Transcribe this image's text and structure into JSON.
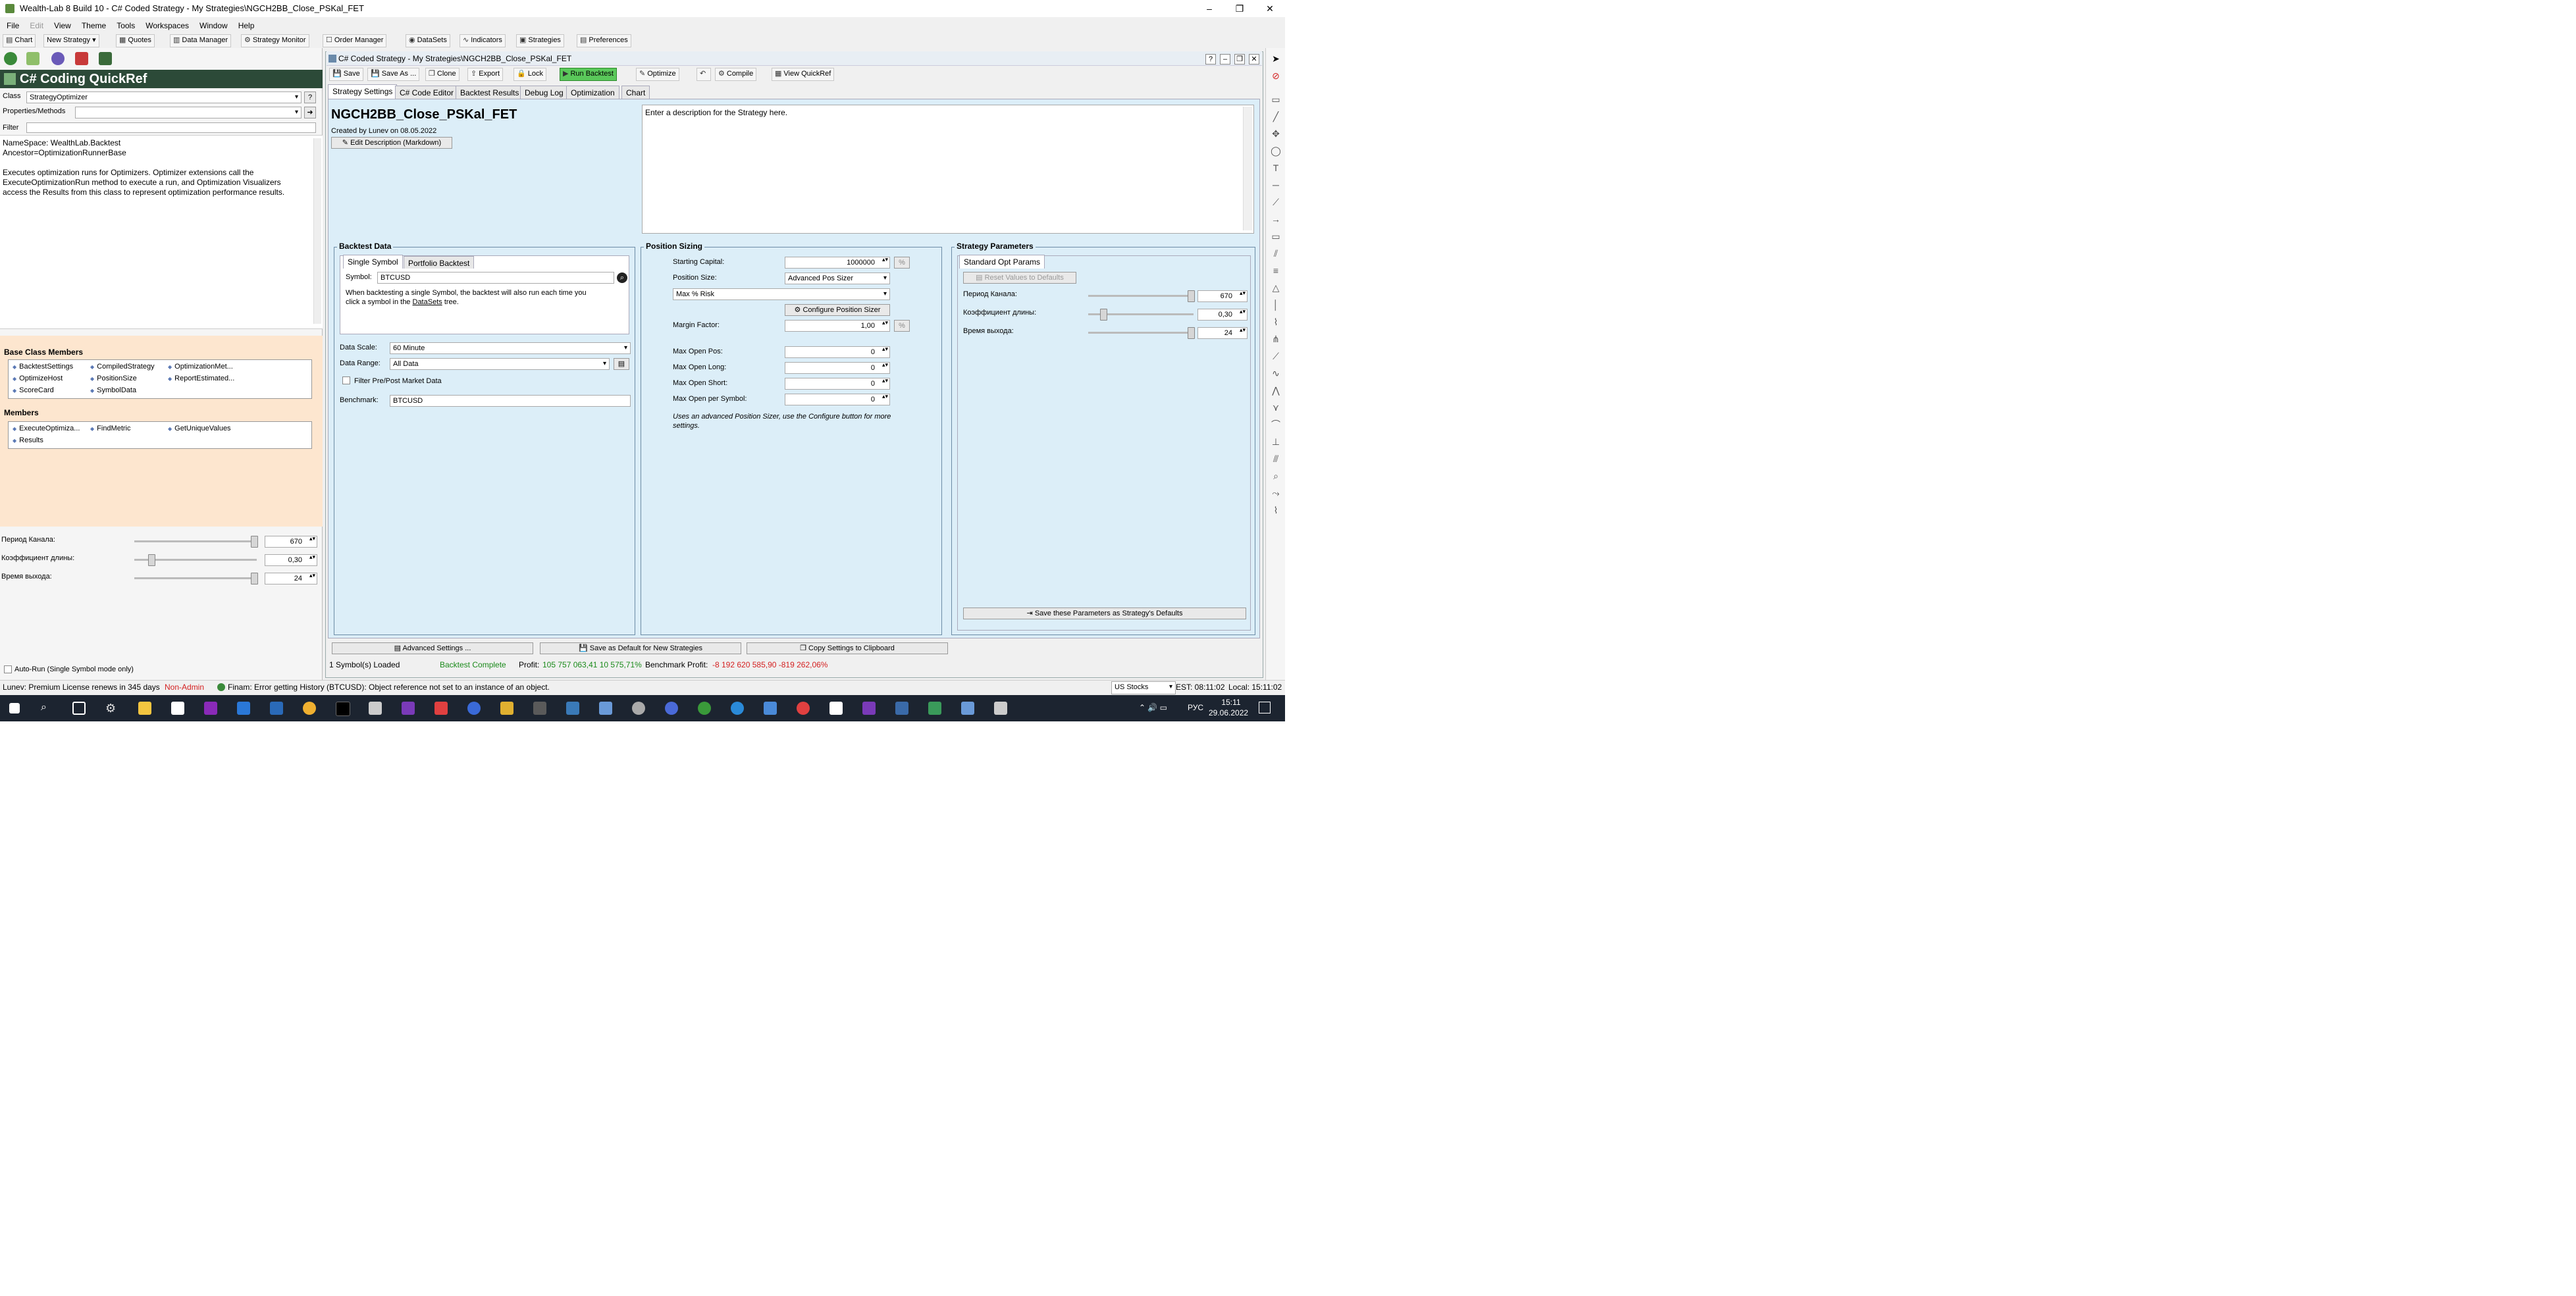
{
  "window": {
    "title": "Wealth-Lab 8 Build 10 - C# Coded Strategy - My Strategies\\NGCH2BB_Close_PSKal_FET",
    "controls": [
      "–",
      "❐",
      "✕"
    ]
  },
  "menu": [
    "File",
    "Edit",
    "View",
    "Theme",
    "Tools",
    "Workspaces",
    "Window",
    "Help"
  ],
  "toolbar": {
    "chart": "Chart",
    "new_strategy": "New Strategy",
    "quotes": "Quotes",
    "data_manager": "Data Manager",
    "strategy_monitor": "Strategy Monitor",
    "order_manager": "Order Manager",
    "datasets": "DataSets",
    "indicators": "Indicators",
    "strategies": "Strategies",
    "preferences": "Preferences"
  },
  "quickref": {
    "title": "C# Coding QuickRef",
    "class_label": "Class",
    "class_value": "StrategyOptimizer",
    "class_help": "?",
    "props_label": "Properties/Methods",
    "filter_label": "Filter",
    "description": [
      "NameSpace: WealthLab.Backtest",
      "Ancestor=OptimizationRunnerBase",
      "",
      "Executes optimization runs for Optimizers. Optimizer extensions call the",
      "ExecuteOptimizationRun method to execute a run, and Optimization Visualizers",
      "access the Results from this class to represent optimization performance results."
    ],
    "base_class_title": "Base Class Members",
    "base_members": [
      "BacktestSettings",
      "CompiledStrategy",
      "OptimizationMet...",
      "OptimizeHost",
      "PositionSize",
      "ReportEstimated...",
      "ScoreCard",
      "SymbolData"
    ],
    "members_title": "Members",
    "members": [
      "ExecuteOptimiza...",
      "FindMetric",
      "GetUniqueValues",
      "Results"
    ]
  },
  "left_params": [
    {
      "label": "Период Канала:",
      "value": "670",
      "level": 1.0
    },
    {
      "label": "Коэффициент длины:",
      "value": "0,30",
      "level": 0.12
    },
    {
      "label": "Время выхода:",
      "value": "24",
      "level": 1.0
    }
  ],
  "autorun_label": "Auto-Run (Single Symbol mode only)",
  "doc": {
    "title": "C# Coded Strategy - My Strategies\\NGCH2BB_Close_PSKal_FET",
    "buttons": {
      "save": "Save",
      "save_as": "Save As ...",
      "clone": "Clone",
      "export": "Export",
      "lock": "Lock",
      "run": "Run Backtest",
      "optimize": "Optimize",
      "compile": "Compile",
      "quickref": "View QuickRef"
    },
    "tabs": [
      "Strategy Settings",
      "C# Code Editor",
      "Backtest Results",
      "Debug Log",
      "Optimization",
      "Chart"
    ]
  },
  "strategy": {
    "name": "NGCH2BB_Close_PSKal_FET",
    "created": "Created by Lunev on 08.05.2022",
    "edit_desc": "Edit Description (Markdown)",
    "description_placeholder": "Enter a description for the Strategy here."
  },
  "backtest_data": {
    "title": "Backtest Data",
    "tabs": [
      "Single Symbol",
      "Portfolio Backtest"
    ],
    "symbol_label": "Symbol:",
    "symbol": "BTCUSD",
    "note_1": "When backtesting a single Symbol, the backtest will also run each time you",
    "note_2": "click a symbol in the",
    "note_link": "DataSets",
    "note_3": "tree.",
    "scale_label": "Data Scale:",
    "scale": "60 Minute",
    "range_label": "Data Range:",
    "range": "All Data",
    "filter_label": "Filter Pre/Post Market Data",
    "benchmark_label": "Benchmark:",
    "benchmark": "BTCUSD"
  },
  "position_sizing": {
    "title": "Position Sizing",
    "starting_capital_label": "Starting Capital:",
    "starting_capital": "1000000",
    "position_size_label": "Position Size:",
    "position_size": "Advanced Pos Sizer",
    "sizer": "Max % Risk",
    "configure": "Configure Position Sizer",
    "margin_label": "Margin Factor:",
    "margin": "1,00",
    "pct": "%",
    "max_open_pos_label": "Max Open Pos:",
    "max_open_pos": "0",
    "max_open_long_label": "Max Open Long:",
    "max_open_long": "0",
    "max_open_short_label": "Max Open Short:",
    "max_open_short": "0",
    "max_open_symbol_label": "Max Open per Symbol:",
    "max_open_symbol": "0",
    "note": "Uses an advanced Position Sizer, use the Configure button for more settings."
  },
  "strategy_params": {
    "title": "Strategy Parameters",
    "tab": "Standard Opt Params",
    "reset": "Reset Values to Defaults",
    "params": [
      {
        "label": "Период Канала:",
        "value": "670",
        "level": 1.0
      },
      {
        "label": "Коэффициент длины:",
        "value": "0,30",
        "level": 0.12
      },
      {
        "label": "Время выхода:",
        "value": "24",
        "level": 1.0
      }
    ],
    "save_defaults": "Save these Parameters as Strategy's Defaults"
  },
  "bottom_buttons": {
    "advanced": "Advanced Settings ...",
    "save_default": "Save as Default for New Strategies",
    "copy": "Copy Settings to Clipboard"
  },
  "status": {
    "loaded": "1 Symbol(s) Loaded",
    "complete": "Backtest Complete",
    "profit_label": "Profit:",
    "profit": "105 757 063,41 10 575,71%",
    "benchmark_label": "Benchmark Profit:",
    "benchmark": "-8 192 620 585,90 -819 262,06%"
  },
  "bottom_status": {
    "license": "Lunev: Premium License renews in 345 days",
    "non_admin": "Non-Admin",
    "error": "Finam: Error getting History (BTCUSD): Object reference not set to an instance of an object.",
    "market": "US Stocks",
    "est": "EST: 08:11:02",
    "local": "Local: 15:11:02"
  },
  "taskbar": {
    "lang": "РУС",
    "time": "15:11",
    "date": "29.06.2022"
  },
  "colors": {
    "accent": "#2c4a38",
    "panel_bg": "#dceef8",
    "peach": "#fde6cf",
    "profit": "#1a8a1a",
    "loss": "#d42020",
    "run_button": "#5ac85a"
  }
}
